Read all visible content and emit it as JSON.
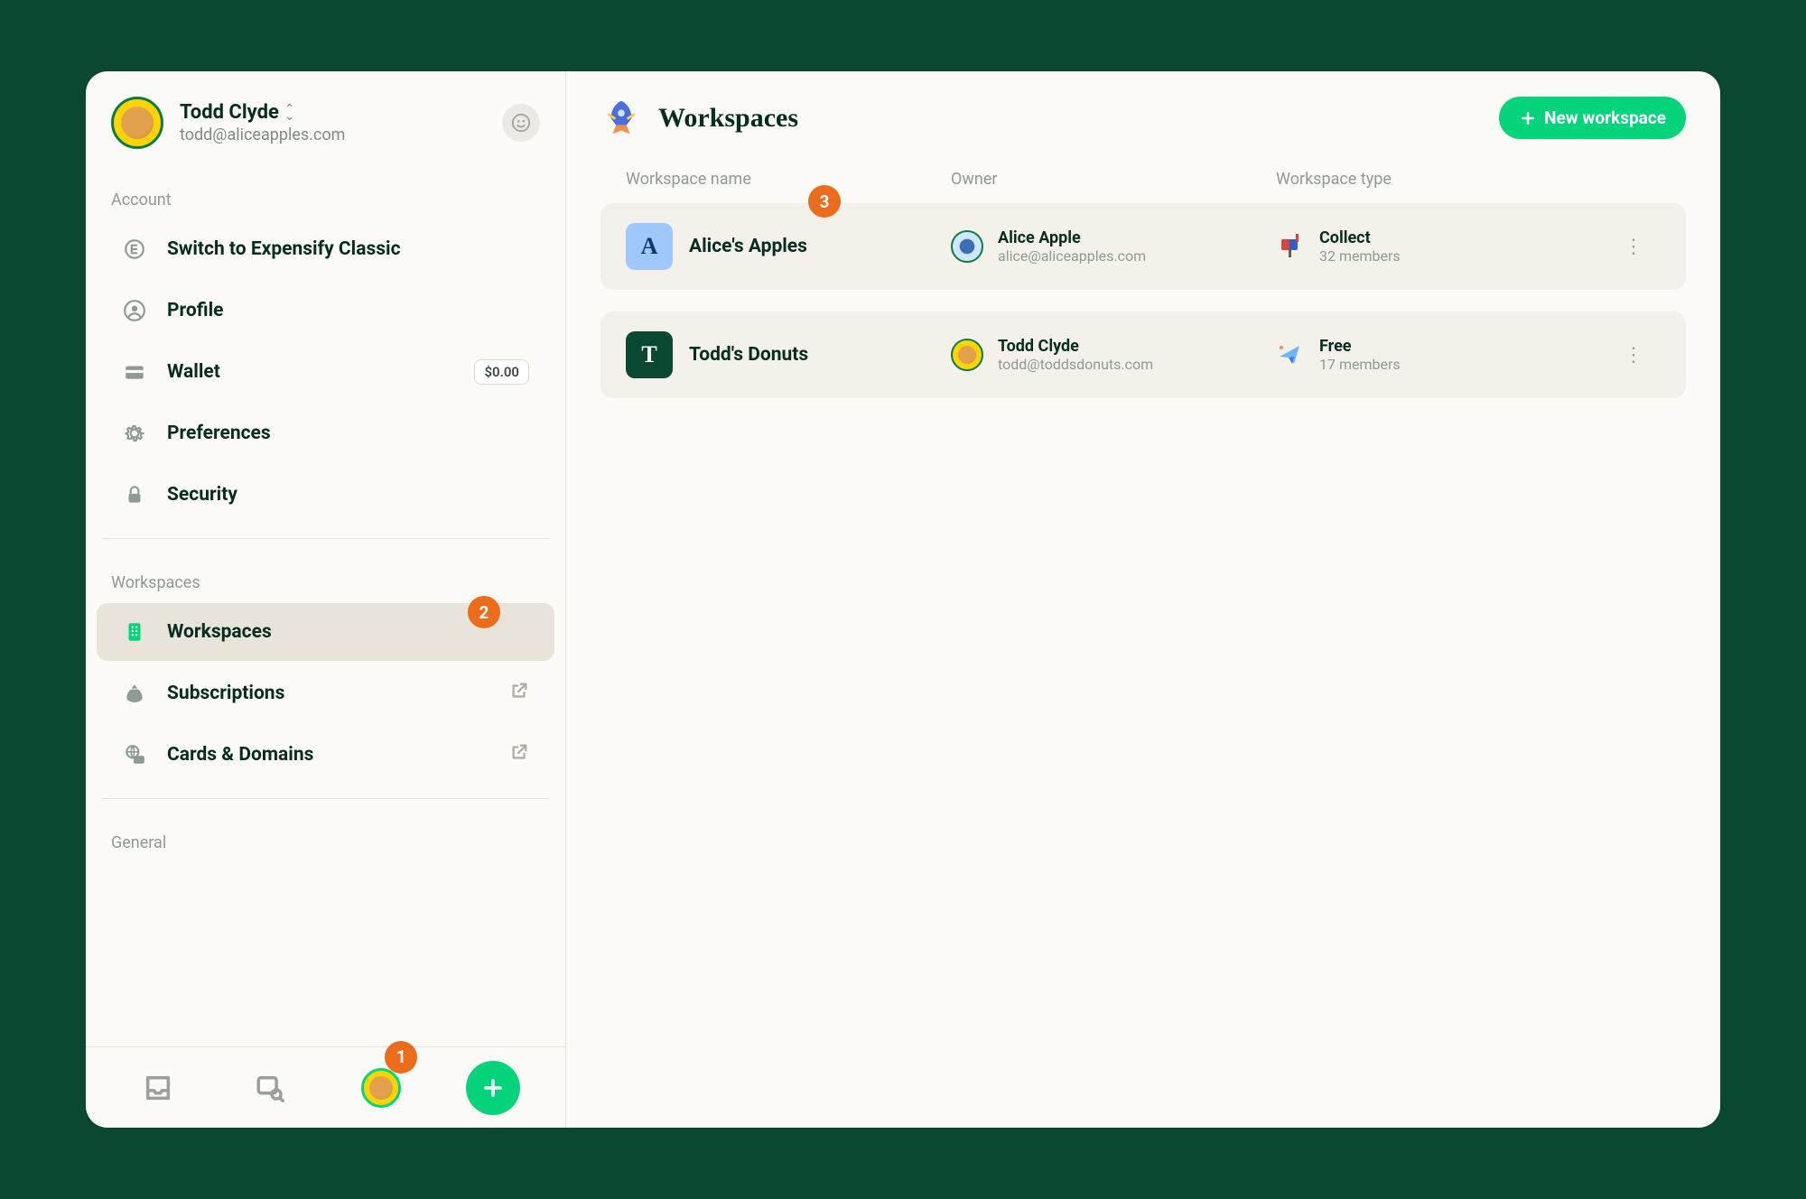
{
  "user": {
    "name": "Todd Clyde",
    "email": "todd@aliceapples.com"
  },
  "sidebar": {
    "sections": {
      "account": "Account",
      "workspaces": "Workspaces",
      "general": "General"
    },
    "items": {
      "switch": "Switch to Expensify Classic",
      "profile": "Profile",
      "wallet": "Wallet",
      "wallet_balance": "$0.00",
      "preferences": "Preferences",
      "security": "Security",
      "workspaces_item": "Workspaces",
      "subscriptions": "Subscriptions",
      "cards": "Cards & Domains"
    }
  },
  "annotations": {
    "badge1": "1",
    "badge2": "2",
    "badge3": "3"
  },
  "main": {
    "title": "Workspaces",
    "new_button": "New workspace",
    "columns": {
      "name": "Workspace name",
      "owner": "Owner",
      "type": "Workspace type"
    },
    "rows": [
      {
        "letter": "A",
        "name": "Alice's Apples",
        "owner_name": "Alice Apple",
        "owner_email": "alice@aliceapples.com",
        "type": "Collect",
        "members": "32 members"
      },
      {
        "letter": "T",
        "name": "Todd's Donuts",
        "owner_name": "Todd Clyde",
        "owner_email": "todd@toddsdonuts.com",
        "type": "Free",
        "members": "17 members"
      }
    ]
  }
}
